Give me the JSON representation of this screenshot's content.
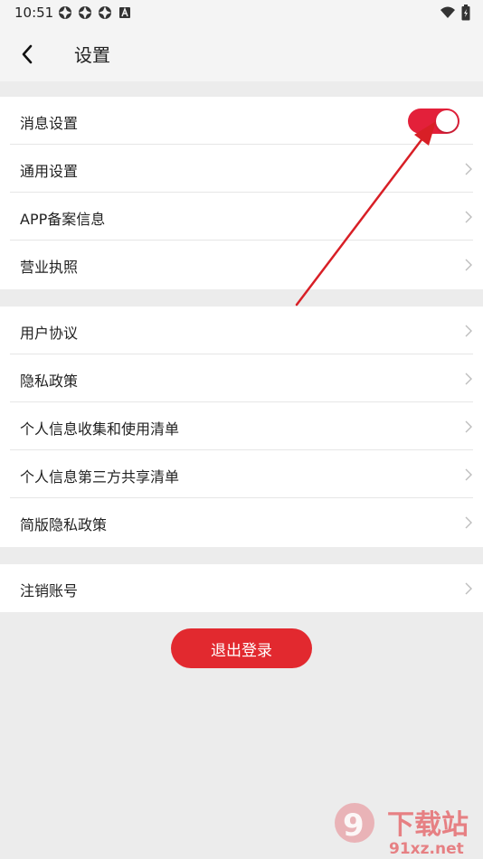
{
  "status_bar": {
    "time": "10:51",
    "notification_icons": [
      "app-icon",
      "app-icon",
      "app-icon",
      "a-icon"
    ],
    "right_icons": [
      "wifi-icon",
      "battery-icon"
    ]
  },
  "header": {
    "title": "设置"
  },
  "sections": [
    {
      "items": [
        {
          "label": "消息设置",
          "control": "toggle",
          "toggle_on": true
        },
        {
          "label": "通用设置",
          "control": "chevron"
        },
        {
          "label": "APP备案信息",
          "control": "chevron"
        },
        {
          "label": "营业执照",
          "control": "chevron"
        }
      ]
    },
    {
      "items": [
        {
          "label": "用户协议",
          "control": "chevron"
        },
        {
          "label": "隐私政策",
          "control": "chevron"
        },
        {
          "label": "个人信息收集和使用清单",
          "control": "chevron"
        },
        {
          "label": "个人信息第三方共享清单",
          "control": "chevron"
        },
        {
          "label": "简版隐私政策",
          "control": "chevron"
        }
      ]
    },
    {
      "items": [
        {
          "label": "注销账号",
          "control": "chevron"
        }
      ]
    }
  ],
  "logout_label": "退出登录",
  "colors": {
    "accent": "#e2292f",
    "toggle_on": "#e3203a",
    "annotation_arrow": "#d81f26",
    "background": "#ececec"
  },
  "watermark": {
    "text_top": "下载站",
    "text_bottom": "91xz.net"
  }
}
